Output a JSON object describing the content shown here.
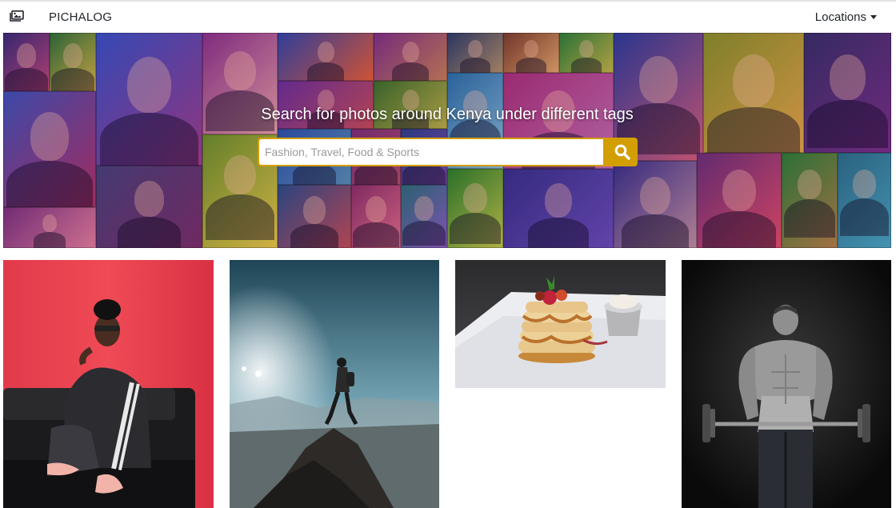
{
  "navbar": {
    "brand_icon": "images-icon",
    "brand": "PICHALOG",
    "locations_label": "Locations",
    "locations_icon": "caret-down-icon"
  },
  "hero": {
    "title": "Search for photos around Kenya under different tags",
    "search_placeholder": "Fashion, Travel, Food & Sports",
    "search_value": "",
    "search_icon": "search-icon",
    "accent_color": "#d39e00"
  },
  "gallery": [
    {
      "subject": "woman-on-sofa-photo"
    },
    {
      "subject": "hiker-on-mountain-photo"
    },
    {
      "subject": "pancakes-photo"
    },
    {
      "subject": "bodybuilder-photo"
    }
  ]
}
